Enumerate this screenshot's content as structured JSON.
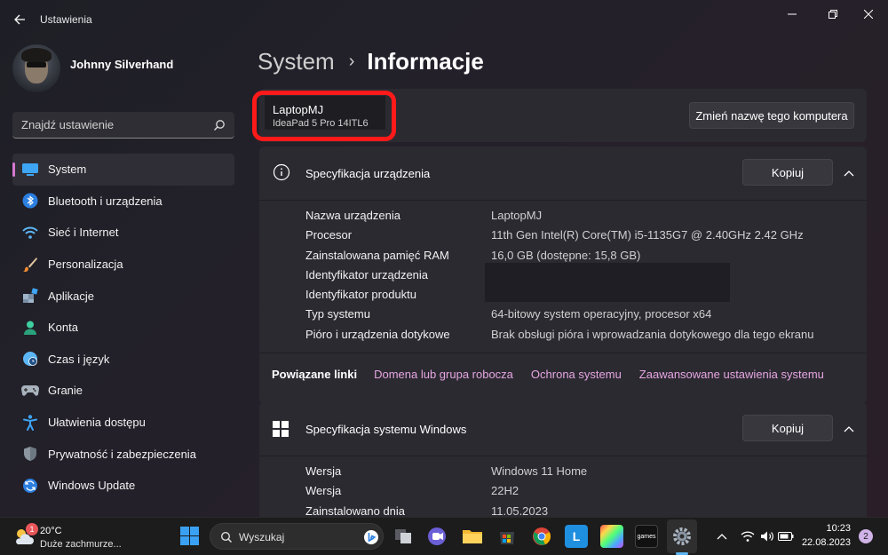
{
  "window": {
    "title": "Ustawienia",
    "back_icon": "arrow-left-icon",
    "controls": [
      "minimize-icon",
      "maximize-icon",
      "close-icon"
    ]
  },
  "profile": {
    "name": "Johnny Silverhand"
  },
  "search": {
    "placeholder": "Znajdź ustawienie",
    "value": ""
  },
  "sidebar": {
    "items": [
      {
        "label": "System",
        "icon": "monitor-icon",
        "active": true
      },
      {
        "label": "Bluetooth i urządzenia",
        "icon": "bluetooth-icon"
      },
      {
        "label": "Sieć i Internet",
        "icon": "wifi-icon"
      },
      {
        "label": "Personalizacja",
        "icon": "brush-icon"
      },
      {
        "label": "Aplikacje",
        "icon": "apps-icon"
      },
      {
        "label": "Konta",
        "icon": "person-icon"
      },
      {
        "label": "Czas i język",
        "icon": "clock-globe-icon"
      },
      {
        "label": "Granie",
        "icon": "gamepad-icon"
      },
      {
        "label": "Ułatwienia dostępu",
        "icon": "accessibility-icon"
      },
      {
        "label": "Prywatność i zabezpieczenia",
        "icon": "shield-icon"
      },
      {
        "label": "Windows Update",
        "icon": "update-icon"
      }
    ]
  },
  "breadcrumb": {
    "parent": "System",
    "separator": "›",
    "current": "Informacje"
  },
  "pc_card": {
    "name": "LaptopMJ",
    "model": "IdeaPad 5 Pro 14ITL6",
    "rename_label": "Zmień nazwę tego komputera"
  },
  "device_spec": {
    "title": "Specyfikacja urządzenia",
    "copy_label": "Kopiuj",
    "rows": [
      {
        "label": "Nazwa urządzenia",
        "value": "LaptopMJ"
      },
      {
        "label": "Procesor",
        "value": "11th Gen Intel(R) Core(TM) i5-1135G7 @ 2.40GHz   2.42 GHz"
      },
      {
        "label": "Zainstalowana pamięć RAM",
        "value": "16,0 GB (dostępne: 15,8 GB)"
      },
      {
        "label": "Identyfikator urządzenia",
        "value": ""
      },
      {
        "label": "Identyfikator produktu",
        "value": ""
      },
      {
        "label": "Typ systemu",
        "value": "64-bitowy system operacyjny, procesor x64"
      },
      {
        "label": "Pióro i urządzenia dotykowe",
        "value": "Brak obsługi pióra i wprowadzania dotykowego dla tego ekranu"
      }
    ]
  },
  "related_links": {
    "label": "Powiązane linki",
    "links": [
      "Domena lub grupa robocza",
      "Ochrona systemu",
      "Zaawansowane ustawienia systemu"
    ]
  },
  "windows_spec": {
    "title": "Specyfikacja systemu Windows",
    "copy_label": "Kopiuj",
    "rows": [
      {
        "label": "Wersja",
        "value": "Windows 11 Home"
      },
      {
        "label": "Wersja",
        "value": "22H2"
      },
      {
        "label": "Zainstalowano dnia",
        "value": "11.05.2023"
      }
    ]
  },
  "taskbar": {
    "weather": {
      "badge": "1",
      "temp": "20°C",
      "desc": "Duże zachmurze..."
    },
    "search_label": "Wyszukaj",
    "apps": [
      "file-explorer-icon",
      "teams-icon",
      "folder-icon",
      "store-icon",
      "chrome-icon",
      "l-app-icon",
      "photo-app-icon",
      "games-icon",
      "settings-icon"
    ],
    "games_label": "games",
    "l_app_label": "L",
    "time": "10:23",
    "date": "22.08.2023",
    "notifications": "2",
    "colors": {
      "accent": "#5cb6f5",
      "sidebar_active": "#d47ad1",
      "highlight": "#ff1a1a",
      "link": "#e6a6e2"
    }
  }
}
